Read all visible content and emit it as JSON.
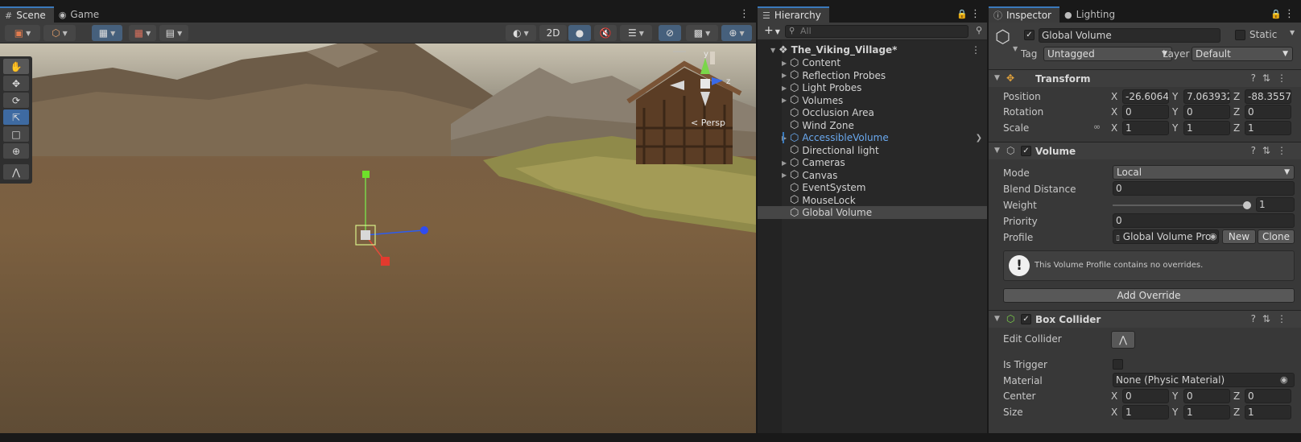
{
  "scene_tabs": {
    "scene": "Scene",
    "game": "Game"
  },
  "scene_toolbar": {
    "two_d": "2D",
    "persp_label": "< Persp"
  },
  "gizmo": {
    "y": "y",
    "z": "z"
  },
  "hierarchy": {
    "tab": "Hierarchy",
    "search_placeholder": "All",
    "root": "The_Viking_Village*",
    "items": [
      {
        "label": "Content"
      },
      {
        "label": "Reflection Probes"
      },
      {
        "label": "Light Probes"
      },
      {
        "label": "Volumes"
      },
      {
        "label": "Occlusion Area"
      },
      {
        "label": "Wind Zone"
      },
      {
        "label": "AccessibleVolume"
      },
      {
        "label": "Directional light"
      },
      {
        "label": "Cameras"
      },
      {
        "label": "Canvas"
      },
      {
        "label": "EventSystem"
      },
      {
        "label": "MouseLock"
      },
      {
        "label": "Global Volume"
      }
    ]
  },
  "inspector": {
    "tab_inspector": "Inspector",
    "tab_lighting": "Lighting",
    "object_name": "Global Volume",
    "static_label": "Static",
    "tag_label": "Tag",
    "tag_value": "Untagged",
    "layer_label": "Layer",
    "layer_value": "Default",
    "transform": {
      "title": "Transform",
      "position_label": "Position",
      "rotation_label": "Rotation",
      "scale_label": "Scale",
      "position": {
        "x": "-26.6064",
        "y": "7.063932",
        "z": "-88.3557"
      },
      "rotation": {
        "x": "0",
        "y": "0",
        "z": "0"
      },
      "scale": {
        "x": "1",
        "y": "1",
        "z": "1"
      }
    },
    "volume": {
      "title": "Volume",
      "mode_label": "Mode",
      "mode_value": "Local",
      "blend_label": "Blend Distance",
      "blend_value": "0",
      "weight_label": "Weight",
      "weight_value": "1",
      "priority_label": "Priority",
      "priority_value": "0",
      "profile_label": "Profile",
      "profile_value": "Global Volume Pro",
      "new_button": "New",
      "clone_button": "Clone",
      "info_text": "This Volume Profile contains no overrides.",
      "add_override": "Add Override"
    },
    "box_collider": {
      "title": "Box Collider",
      "edit_label": "Edit Collider",
      "trigger_label": "Is Trigger",
      "material_label": "Material",
      "material_value": "None (Physic Material)",
      "center_label": "Center",
      "size_label": "Size",
      "center": {
        "x": "0",
        "y": "0",
        "z": "0"
      },
      "size": {
        "x": "1",
        "y": "1",
        "z": "1"
      }
    },
    "axis": {
      "x": "X",
      "y": "Y",
      "z": "Z"
    }
  }
}
